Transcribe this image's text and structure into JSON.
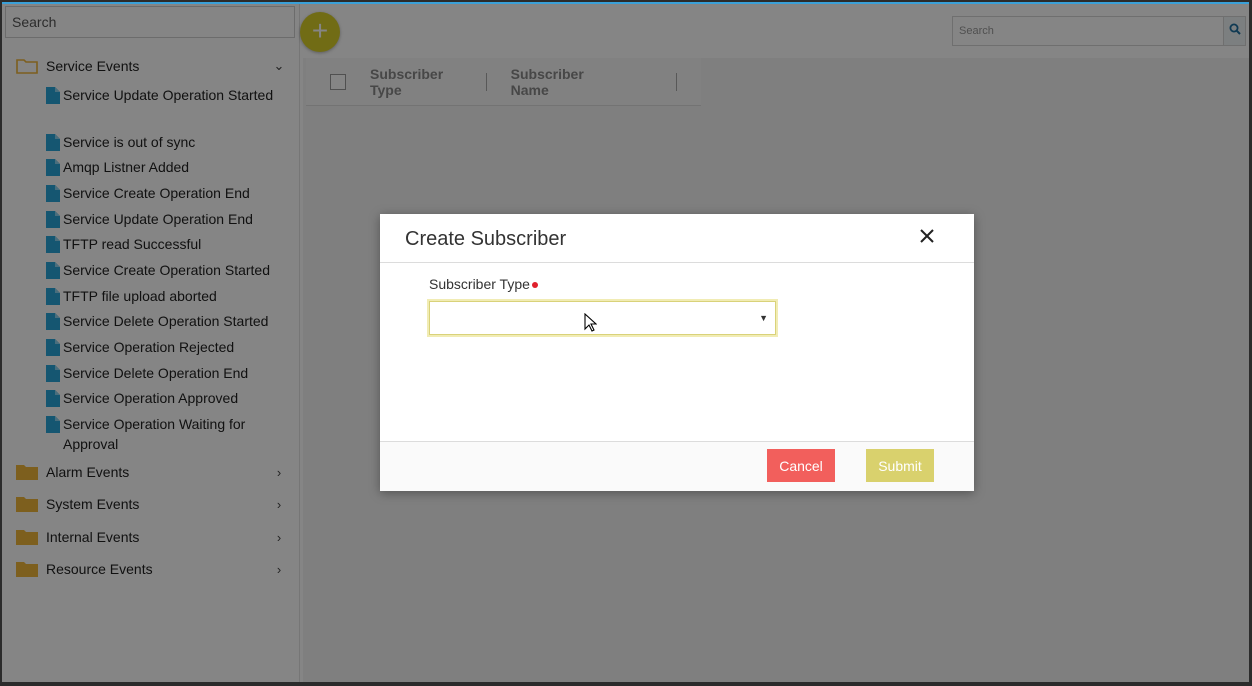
{
  "sidebar": {
    "search_placeholder": "Search",
    "open_folder": {
      "label": "Service Events",
      "items": [
        "Service Update Operation Started",
        "Service is out of sync",
        "Amqp Listner Added",
        "Service Create Operation End",
        "Service Update Operation End",
        "TFTP read Successful",
        "Service Create Operation Started",
        "TFTP file upload aborted",
        "Service Delete Operation Started",
        "Service Operation Rejected",
        "Service Delete Operation End",
        "Service Operation Approved",
        "Service Operation Waiting for Approval"
      ]
    },
    "folders": [
      {
        "label": "Alarm Events"
      },
      {
        "label": "System Events"
      },
      {
        "label": "Internal Events"
      },
      {
        "label": "Resource Events"
      }
    ]
  },
  "main": {
    "add_button_label": "+",
    "search_placeholder": "Search",
    "table_headers": [
      "Subscriber Type",
      "Subscriber Name"
    ]
  },
  "modal": {
    "title": "Create Subscriber",
    "field_label": "Subscriber Type",
    "field_value": "",
    "cancel_label": "Cancel",
    "submit_label": "Submit"
  },
  "colors": {
    "accent_yellow": "#d8cf2a",
    "folder": "#f0b63a",
    "doc": "#2aa6d8",
    "cancel": "#f25f5c",
    "submit": "#d9d16d",
    "required": "#e0202c"
  }
}
